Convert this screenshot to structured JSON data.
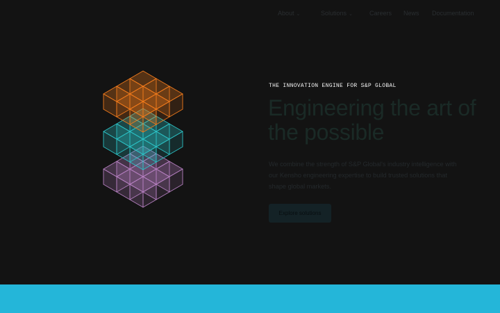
{
  "nav": {
    "items": [
      {
        "label": "About",
        "has_dropdown": true
      },
      {
        "label": "Solutions",
        "has_dropdown": true
      },
      {
        "label": "Careers",
        "has_dropdown": false
      },
      {
        "label": "News",
        "has_dropdown": false
      },
      {
        "label": "Documentation",
        "has_dropdown": false
      }
    ],
    "dropdown_icon": "chevron-down-icon"
  },
  "hero": {
    "eyebrow": "THE INNOVATION ENGINE FOR S&P GLOBAL",
    "headline": "Engineering the art of the possible",
    "description": "We combine the strength of S&P Global's industry intelligence with our Kensho engineering expertise to build trusted solutions that shape global markets.",
    "cta_label": "Explore solutions"
  },
  "artwork": {
    "description_icon": "isometric-cube-stack",
    "layers": [
      {
        "name": "bottom",
        "color": "#b57fc0"
      },
      {
        "name": "middle",
        "color": "#2cc1c4"
      },
      {
        "name": "top",
        "color": "#f07a1c"
      }
    ]
  },
  "colors": {
    "background": "#131313",
    "accent_band": "#24b6d9",
    "eyebrow": "#f2f2f2"
  }
}
